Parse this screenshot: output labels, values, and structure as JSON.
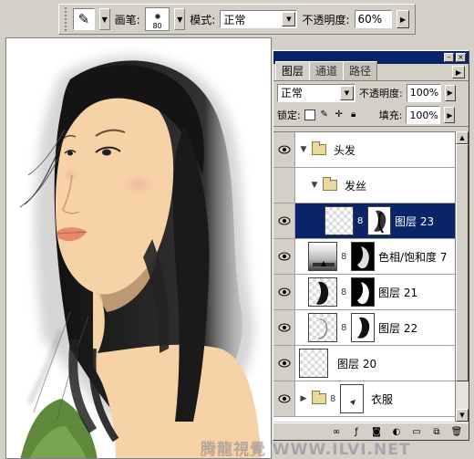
{
  "options_bar": {
    "brush_label": "画笔:",
    "brush_size": "80",
    "mode_label": "模式:",
    "mode_value": "正常",
    "opacity_label": "不透明度:",
    "opacity_value": "60%"
  },
  "layers_panel": {
    "tabs": [
      "图层",
      "通道",
      "路径"
    ],
    "blend_mode": "正常",
    "opacity_label": "不透明度:",
    "opacity_value": "100%",
    "lock_label": "锁定:",
    "fill_label": "填充:",
    "fill_value": "100%",
    "layers": [
      {
        "name": "头发",
        "kind": "group",
        "expanded": true,
        "visible": true,
        "selected": false
      },
      {
        "name": "发丝",
        "kind": "group",
        "expanded": true,
        "visible": false,
        "selected": false
      },
      {
        "name": "图层 23",
        "kind": "layer-with-mask",
        "visible": true,
        "selected": true
      },
      {
        "name": "色相/饱和度 7",
        "kind": "adjustment",
        "visible": true,
        "selected": false
      },
      {
        "name": "图层 21",
        "kind": "layer-with-mask",
        "visible": true,
        "selected": false
      },
      {
        "name": "图层 22",
        "kind": "layer-with-mask",
        "visible": true,
        "selected": false
      },
      {
        "name": "图层 20",
        "kind": "layer",
        "visible": true,
        "selected": false
      },
      {
        "name": "衣服",
        "kind": "group",
        "expanded": false,
        "visible": true,
        "selected": false
      }
    ]
  },
  "watermark": "腾龍視覺 WWW.ILVI.NET",
  "colors": {
    "selection": "#0a246a",
    "panel_bg": "#d4d0c8",
    "skin": "#f6d2a6"
  }
}
